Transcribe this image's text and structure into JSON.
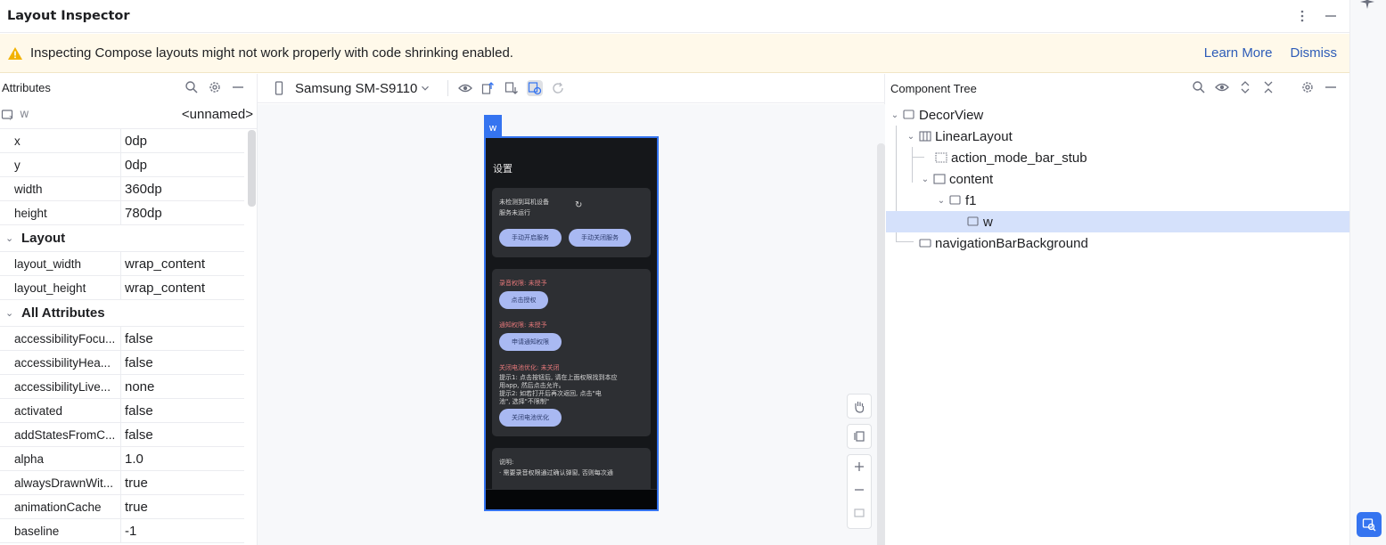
{
  "window": {
    "title": "Layout Inspector"
  },
  "banner": {
    "message": "Inspecting Compose layouts might not work properly with code shrinking enabled.",
    "learn_more": "Learn More",
    "dismiss": "Dismiss"
  },
  "attributes": {
    "header": "Attributes",
    "selected_view": "w",
    "selected_id": "<unnamed>",
    "basic": [
      {
        "key": "x",
        "value": "0dp"
      },
      {
        "key": "y",
        "value": "0dp"
      },
      {
        "key": "width",
        "value": "360dp"
      },
      {
        "key": "height",
        "value": "780dp"
      }
    ],
    "layout_section": "Layout",
    "layout": [
      {
        "key": "layout_width",
        "value": "wrap_content"
      },
      {
        "key": "layout_height",
        "value": "wrap_content"
      }
    ],
    "all_section": "All Attributes",
    "all": [
      {
        "key": "accessibilityFocu...",
        "value": "false"
      },
      {
        "key": "accessibilityHea...",
        "value": "false"
      },
      {
        "key": "accessibilityLive...",
        "value": "none"
      },
      {
        "key": "activated",
        "value": "false"
      },
      {
        "key": "addStatesFromC...",
        "value": "false"
      },
      {
        "key": "alpha",
        "value": "1.0"
      },
      {
        "key": "alwaysDrawnWit...",
        "value": "true"
      },
      {
        "key": "animationCache",
        "value": "true"
      },
      {
        "key": "baseline",
        "value": "-1"
      }
    ]
  },
  "center": {
    "device": "Samsung SM-S9110",
    "phone_tag": "w",
    "screen": {
      "title": "设置",
      "card1": {
        "line1": "未检测到耳机设备",
        "line2": "服务未运行",
        "btn1": "手动开启服务",
        "btn2": "手动关闭服务"
      },
      "card2": {
        "perm1": "录音权限: 未授予",
        "perm1_btn": "点击授权",
        "perm2": "通知权限: 未授予",
        "perm2_btn": "申请通知权限",
        "perm3": "关闭电池优化: 未关闭",
        "note1": "提示1: 点击按钮后, 请在上面权限找到本应",
        "note2": "用app, 然后点击允许。",
        "note3": "提示2: 如若打开后再次返回, 点击\"电",
        "note4": "池\", 选择\"不限制\"",
        "perm3_btn": "关闭电池优化"
      },
      "card3": {
        "line1": "说明:",
        "line2": "· 需要录音权限通过确认弹窗, 否则每次通"
      }
    }
  },
  "tree": {
    "header": "Component Tree",
    "nodes": [
      {
        "label": "DecorView"
      },
      {
        "label": "LinearLayout"
      },
      {
        "label": "action_mode_bar_stub"
      },
      {
        "label": "content"
      },
      {
        "label": "f1"
      },
      {
        "label": "w"
      },
      {
        "label": "navigationBarBackground"
      }
    ]
  },
  "colors": {
    "accent": "#3574f0",
    "banner_bg": "#fff9ea",
    "link": "#2e5cb8",
    "selection": "#d5e1fb"
  }
}
